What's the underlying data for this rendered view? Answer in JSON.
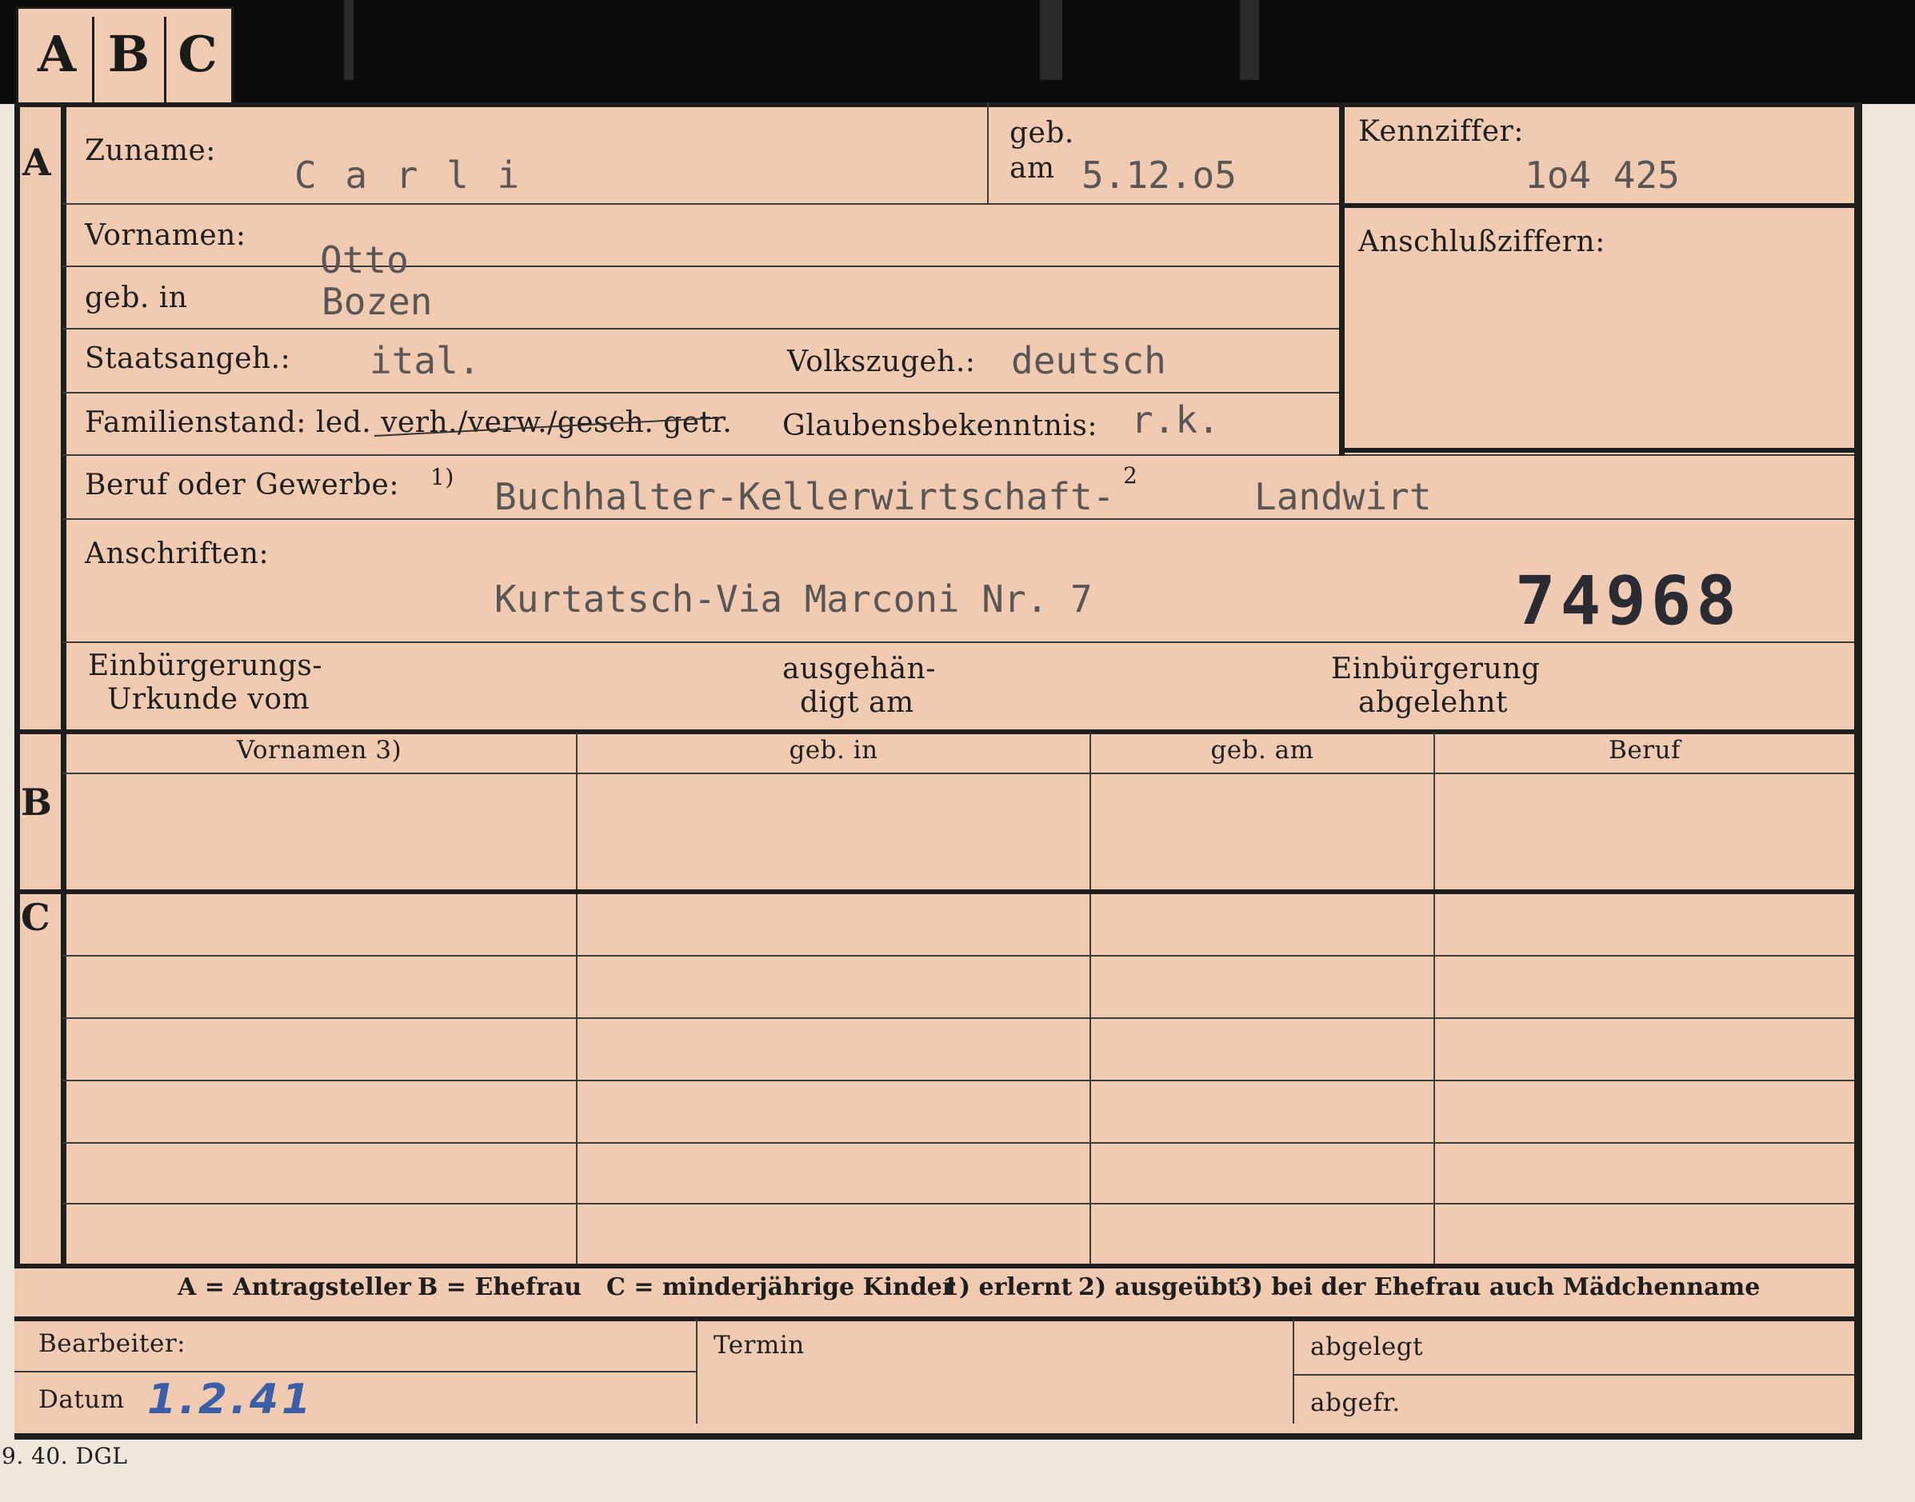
{
  "tab_letters": [
    "A",
    "B",
    "C"
  ],
  "section_a": {
    "letter": "A",
    "zuname_label": "Zuname:",
    "zuname_value": "C a r l i",
    "geb_label": "geb.",
    "am_label": "am",
    "geb_am_value": "5.12.o5",
    "kennziffer_label": "Kennziffer:",
    "kennziffer_value": "1o4 425",
    "anschluss_label": "Anschlußziffern:",
    "vornamen_label": "Vornamen:",
    "vornamen_value": "Otto",
    "geb_in_label": "geb. in",
    "geb_in_value": "Bozen",
    "staat_label": "Staatsangeh.:",
    "staat_value": "ital.",
    "volks_label": "Volkszugeh.:",
    "volks_value": "deutsch",
    "familienstand_label": "Familienstand: led. verh./verw./gesch. getr.",
    "glaube_label": "Glaubensbekenntnis:",
    "glaube_value": "r.k.",
    "beruf_label": "Beruf oder Gewerbe:",
    "beruf_note_1": "1)",
    "beruf_value": "Buchhalter-Kellerwirtschaft-",
    "beruf_note_2": "2",
    "beruf_value_2": "Landwirt",
    "anschriften_label": "Anschriften:",
    "anschrift_value": "Kurtatsch-Via Marconi Nr. 7",
    "stamp_number": "74968",
    "einb_urkunde_line1": "Einbürgerungs-",
    "einb_urkunde_line2": "Urkunde vom",
    "ausgehaendigt_line1": "ausgehän-",
    "ausgehaendigt_line2": "digt am",
    "einb_abgelehnt_line1": "Einbürgerung",
    "einb_abgelehnt_line2": "abgelehnt"
  },
  "section_b": {
    "letter": "B",
    "columns": [
      "Vornamen 3)",
      "geb. in",
      "geb. am",
      "Beruf"
    ]
  },
  "section_c": {
    "letter": "C"
  },
  "legend": {
    "a": "A = Antragsteller",
    "b": "B = Ehefrau",
    "c": "C = minderjährige Kinder",
    "n1": "1) erlernt",
    "n2": "2) ausgeübt",
    "n3": "3) bei der Ehefrau auch Mädchenname"
  },
  "footer": {
    "bearbeiter_label": "Bearbeiter:",
    "datum_label": "Datum",
    "datum_value": "1.2.41",
    "termin_label": "Termin",
    "abgelegt_label": "abgelegt",
    "abgefr_label": "abgefr."
  },
  "printer_mark": "9. 40. DGL"
}
